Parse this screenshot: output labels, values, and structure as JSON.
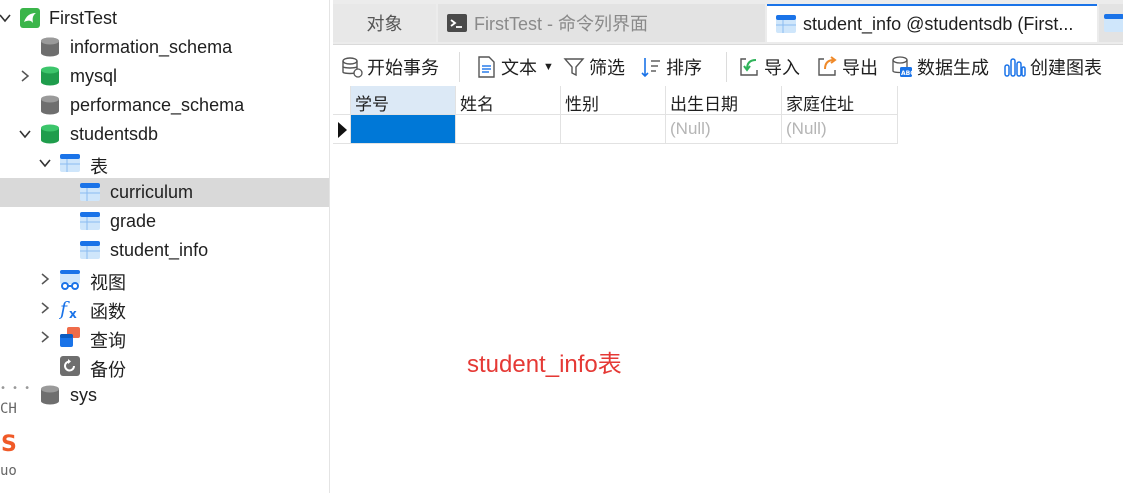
{
  "sidebar": {
    "connection": "FirstTest",
    "databases": [
      {
        "name": "information_schema",
        "expanded": false
      },
      {
        "name": "mysql",
        "expanded": false
      },
      {
        "name": "performance_schema",
        "expanded": false
      },
      {
        "name": "studentsdb",
        "expanded": true
      },
      {
        "name": "sys",
        "expanded": false
      }
    ],
    "studentsdb_groups": {
      "tables": "表",
      "views": "视图",
      "functions": "函数",
      "queries": "查询",
      "backups": "备份"
    },
    "tables": [
      "curriculum",
      "grade",
      "student_info"
    ],
    "selected_table": "curriculum",
    "decor_text": [
      "CH",
      "uo"
    ]
  },
  "tabs": {
    "objects": "对象",
    "command": "FirstTest - 命令列界面",
    "active": "student_info @studentsdb (First..."
  },
  "toolbar": {
    "begin_transaction": "开始事务",
    "text": "文本",
    "filter": "筛选",
    "sort": "排序",
    "import": "导入",
    "export": "导出",
    "data_generation": "数据生成",
    "create_chart": "创建图表"
  },
  "grid": {
    "columns": [
      "学号",
      "姓名",
      "性别",
      "出生日期",
      "家庭住址"
    ],
    "rows": [
      [
        "",
        "",
        "",
        "(Null)",
        "(Null)"
      ]
    ]
  },
  "annotation": "student_info表",
  "colors": {
    "accent": "#0078d7",
    "selection_row": "#d9d9d9",
    "header_selected": "#dce9f6",
    "annotation": "#e53935",
    "db_green": "#2fb35a",
    "db_gray": "#6e6e6e"
  }
}
